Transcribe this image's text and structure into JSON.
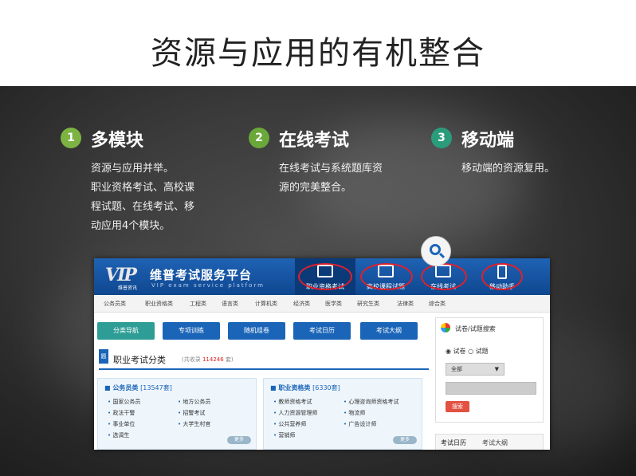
{
  "slide_title": "资源与应用的有机整合",
  "features": [
    {
      "num": "1",
      "title": "多模块",
      "color": "#7cb342",
      "lines": [
        "资源与应用并举。",
        "职业资格考试、高校课",
        "程试题、在线考试、移",
        "动应用4个模块。"
      ]
    },
    {
      "num": "2",
      "title": "在线考试",
      "color": "#6aa83a",
      "lines": [
        "在线考试与系统题库资",
        "源的完美整合。"
      ]
    },
    {
      "num": "3",
      "title": "移动端",
      "color": "#2a9c7c",
      "lines": [
        "移动端的资源复用。"
      ]
    }
  ],
  "site": {
    "logo_text": "VIP",
    "logo_sub": "维普资讯",
    "name": "维普考试服务平台",
    "subtitle": "VIP exam service platform",
    "header_nav": [
      "职业资格考试",
      "高校课程试题",
      "在线考试",
      "移动助手"
    ],
    "categories": [
      "公务员类",
      "职业资格类",
      "工程类",
      "语言类",
      "计算机类",
      "经济类",
      "医学类",
      "研究生类",
      "法律类",
      "综合类"
    ],
    "buttons": [
      "分类导航",
      "专项训练",
      "随机组卷",
      "考试日历",
      "考试大纲"
    ],
    "section_title": "职业考试分类",
    "section_count_prefix": "(共收录",
    "section_count": "114246",
    "section_count_suffix": "套)",
    "boxes": [
      {
        "title": "公务员类",
        "count": "[13547套]",
        "items": [
          "国家公务员",
          "地方公务员",
          "政法干警",
          "招警考试",
          "事业单位",
          "大学生村官",
          "选调生"
        ],
        "more": "更多"
      },
      {
        "title": "职业资格类",
        "count": "[6330套]",
        "items": [
          "教师资格考试",
          "心理咨询师资格考试",
          "人力资源管理师",
          "物流师",
          "公共营养师",
          "广告设计师",
          "营销师"
        ],
        "more": "更多"
      }
    ],
    "sidebar": {
      "title": "试卷/试题搜索",
      "radio1": "试卷",
      "radio2": "试题",
      "select_value": "全部",
      "search_button": "搜索"
    },
    "tabs": [
      "考试日历",
      "考试大纲"
    ]
  }
}
